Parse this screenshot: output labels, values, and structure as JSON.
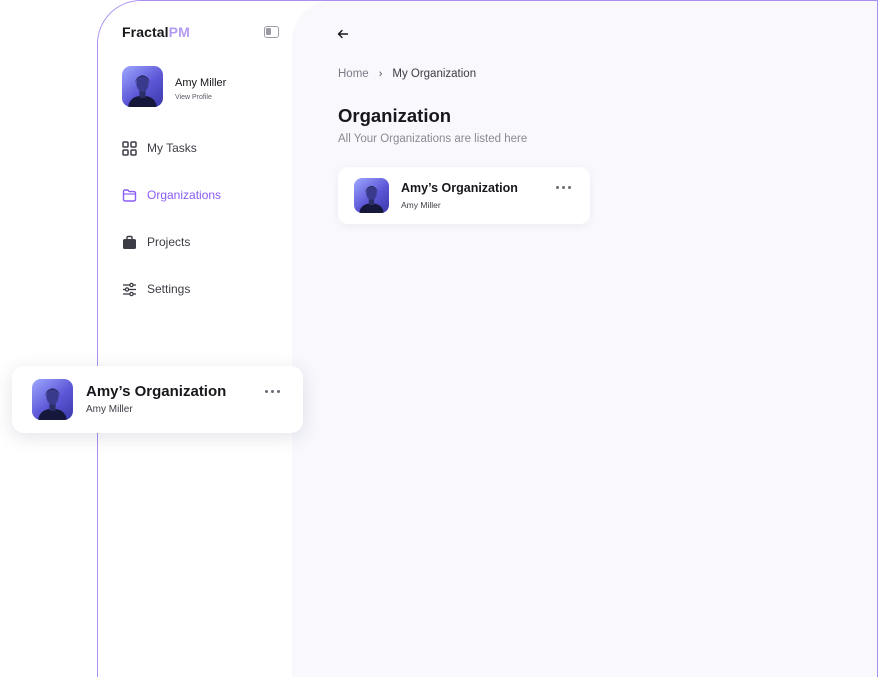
{
  "app": {
    "brand_main": "Fractal",
    "brand_accent": "PM",
    "accent_color": "#8b5cf6"
  },
  "sidebar": {
    "profile": {
      "name": "Amy Miller",
      "link": "View Profile"
    },
    "items": [
      {
        "label": "My Tasks",
        "icon": "grid-icon",
        "active": false
      },
      {
        "label": "Organizations",
        "icon": "folder-icon",
        "active": true
      },
      {
        "label": "Projects",
        "icon": "briefcase-icon",
        "active": false
      },
      {
        "label": "Settings",
        "icon": "sliders-icon",
        "active": false
      }
    ]
  },
  "main": {
    "breadcrumb": {
      "home": "Home",
      "separator": "›",
      "current": "My Organization"
    },
    "title": "Organization",
    "subtitle": "All Your Organizations are listed here",
    "organizations": [
      {
        "name": "Amy’s Organization",
        "owner": "Amy Miller"
      }
    ]
  },
  "floating_card": {
    "name": "Amy’s Organization",
    "owner": "Amy Miller"
  }
}
